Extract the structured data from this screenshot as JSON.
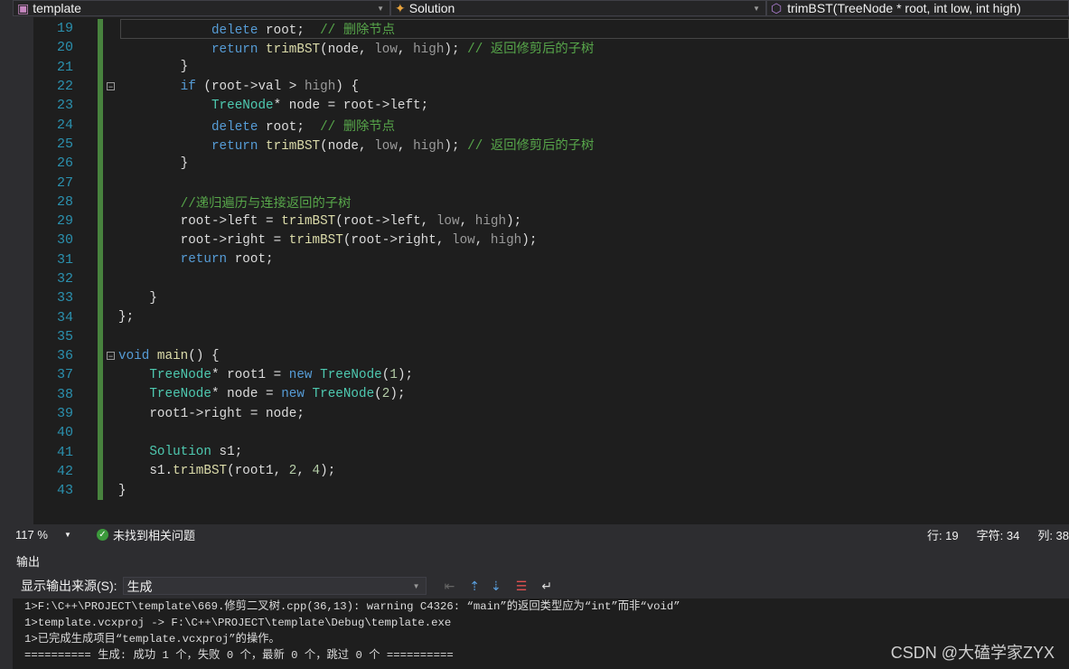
{
  "nav": {
    "project": "template",
    "class": "Solution",
    "member": "trimBST(TreeNode * root, int low, int high)"
  },
  "code": [
    {
      "n": "19",
      "t": [
        [
          "            ",
          ""
        ],
        [
          "delete",
          "kw"
        ],
        [
          " root;  ",
          ""
        ],
        [
          "// 删除节点",
          "cm"
        ]
      ]
    },
    {
      "n": "20",
      "t": [
        [
          "            ",
          ""
        ],
        [
          "return",
          "kw"
        ],
        [
          " ",
          ""
        ],
        [
          "trimBST",
          "fn"
        ],
        [
          "(node, ",
          ""
        ],
        [
          "low",
          "pa"
        ],
        [
          ", ",
          ""
        ],
        [
          "high",
          "pa"
        ],
        [
          "); ",
          ""
        ],
        [
          "// 返回修剪后的子树",
          "cm"
        ]
      ]
    },
    {
      "n": "21",
      "t": [
        [
          "        }",
          ""
        ]
      ]
    },
    {
      "n": "22",
      "t": [
        [
          "        ",
          ""
        ],
        [
          "if",
          "kw"
        ],
        [
          " (root->",
          ""
        ],
        [
          "val",
          "mb"
        ],
        [
          " > ",
          ""
        ],
        [
          "high",
          "pa"
        ],
        [
          ") {",
          ""
        ]
      ]
    },
    {
      "n": "23",
      "t": [
        [
          "            ",
          ""
        ],
        [
          "TreeNode",
          "ty"
        ],
        [
          "* node = root->",
          ""
        ],
        [
          "left",
          "mb"
        ],
        [
          ";",
          ""
        ]
      ]
    },
    {
      "n": "24",
      "t": [
        [
          "            ",
          ""
        ],
        [
          "delete",
          "kw"
        ],
        [
          " root;  ",
          ""
        ],
        [
          "// 删除节点",
          "cm"
        ]
      ]
    },
    {
      "n": "25",
      "t": [
        [
          "            ",
          ""
        ],
        [
          "return",
          "kw"
        ],
        [
          " ",
          ""
        ],
        [
          "trimBST",
          "fn"
        ],
        [
          "(node, ",
          ""
        ],
        [
          "low",
          "pa"
        ],
        [
          ", ",
          ""
        ],
        [
          "high",
          "pa"
        ],
        [
          "); ",
          ""
        ],
        [
          "// 返回修剪后的子树",
          "cm"
        ]
      ]
    },
    {
      "n": "26",
      "t": [
        [
          "        }",
          ""
        ]
      ]
    },
    {
      "n": "27",
      "t": []
    },
    {
      "n": "28",
      "t": [
        [
          "        ",
          ""
        ],
        [
          "//递归遍历与连接返回的子树",
          "cm"
        ]
      ]
    },
    {
      "n": "29",
      "t": [
        [
          "        root->",
          ""
        ],
        [
          "left",
          "mb"
        ],
        [
          " = ",
          ""
        ],
        [
          "trimBST",
          "fn"
        ],
        [
          "(root->",
          ""
        ],
        [
          "left",
          "mb"
        ],
        [
          ", ",
          ""
        ],
        [
          "low",
          "pa"
        ],
        [
          ", ",
          ""
        ],
        [
          "high",
          "pa"
        ],
        [
          ");",
          ""
        ]
      ]
    },
    {
      "n": "30",
      "t": [
        [
          "        root->",
          ""
        ],
        [
          "right",
          "mb"
        ],
        [
          " = ",
          ""
        ],
        [
          "trimBST",
          "fn"
        ],
        [
          "(root->",
          ""
        ],
        [
          "right",
          "mb"
        ],
        [
          ", ",
          ""
        ],
        [
          "low",
          "pa"
        ],
        [
          ", ",
          ""
        ],
        [
          "high",
          "pa"
        ],
        [
          ");",
          ""
        ]
      ]
    },
    {
      "n": "31",
      "t": [
        [
          "        ",
          ""
        ],
        [
          "return",
          "kw"
        ],
        [
          " root;",
          ""
        ]
      ]
    },
    {
      "n": "32",
      "t": []
    },
    {
      "n": "33",
      "t": [
        [
          "    }",
          ""
        ]
      ]
    },
    {
      "n": "34",
      "t": [
        [
          "};",
          ""
        ]
      ]
    },
    {
      "n": "35",
      "t": []
    },
    {
      "n": "36",
      "t": [
        [
          "void",
          "kw"
        ],
        [
          " ",
          ""
        ],
        [
          "main",
          "fn"
        ],
        [
          "() {",
          ""
        ]
      ]
    },
    {
      "n": "37",
      "t": [
        [
          "    ",
          ""
        ],
        [
          "TreeNode",
          "ty"
        ],
        [
          "* root1 = ",
          ""
        ],
        [
          "new",
          "kw"
        ],
        [
          " ",
          ""
        ],
        [
          "TreeNode",
          "ty"
        ],
        [
          "(",
          ""
        ],
        [
          "1",
          "nu"
        ],
        [
          ");",
          ""
        ]
      ]
    },
    {
      "n": "38",
      "t": [
        [
          "    ",
          ""
        ],
        [
          "TreeNode",
          "ty"
        ],
        [
          "* node = ",
          ""
        ],
        [
          "new",
          "kw"
        ],
        [
          " ",
          ""
        ],
        [
          "TreeNode",
          "ty"
        ],
        [
          "(",
          ""
        ],
        [
          "2",
          "nu"
        ],
        [
          ");",
          ""
        ]
      ]
    },
    {
      "n": "39",
      "t": [
        [
          "    root1->",
          ""
        ],
        [
          "right",
          "mb"
        ],
        [
          " = node;",
          ""
        ]
      ]
    },
    {
      "n": "40",
      "t": []
    },
    {
      "n": "41",
      "t": [
        [
          "    ",
          ""
        ],
        [
          "Solution",
          "ty"
        ],
        [
          " s1;",
          ""
        ]
      ]
    },
    {
      "n": "42",
      "t": [
        [
          "    s1.",
          ""
        ],
        [
          "trimBST",
          "fn"
        ],
        [
          "(root1, ",
          ""
        ],
        [
          "2",
          "nu"
        ],
        [
          ", ",
          ""
        ],
        [
          "4",
          "nu"
        ],
        [
          ");",
          ""
        ]
      ]
    },
    {
      "n": "43",
      "t": [
        [
          "}",
          ""
        ]
      ]
    }
  ],
  "status": {
    "zoom": "117 %",
    "issues": "未找到相关问题",
    "line": "行: 19",
    "char": "字符: 34",
    "col": "列: 38"
  },
  "output": {
    "title": "输出",
    "source_label": "显示输出来源(S):",
    "source_value": "生成",
    "lines": [
      "1>F:\\C++\\PROJECT\\template\\669.修剪二叉树.cpp(36,13): warning C4326: “main”的返回类型应为“int”而非“void”",
      "1>template.vcxproj -> F:\\C++\\PROJECT\\template\\Debug\\template.exe",
      "1>已完成生成项目“template.vcxproj”的操作。",
      "========== 生成: 成功 1 个，失败 0 个，最新 0 个，跳过 0 个 =========="
    ]
  },
  "watermark": "CSDN @大磕学家ZYX"
}
